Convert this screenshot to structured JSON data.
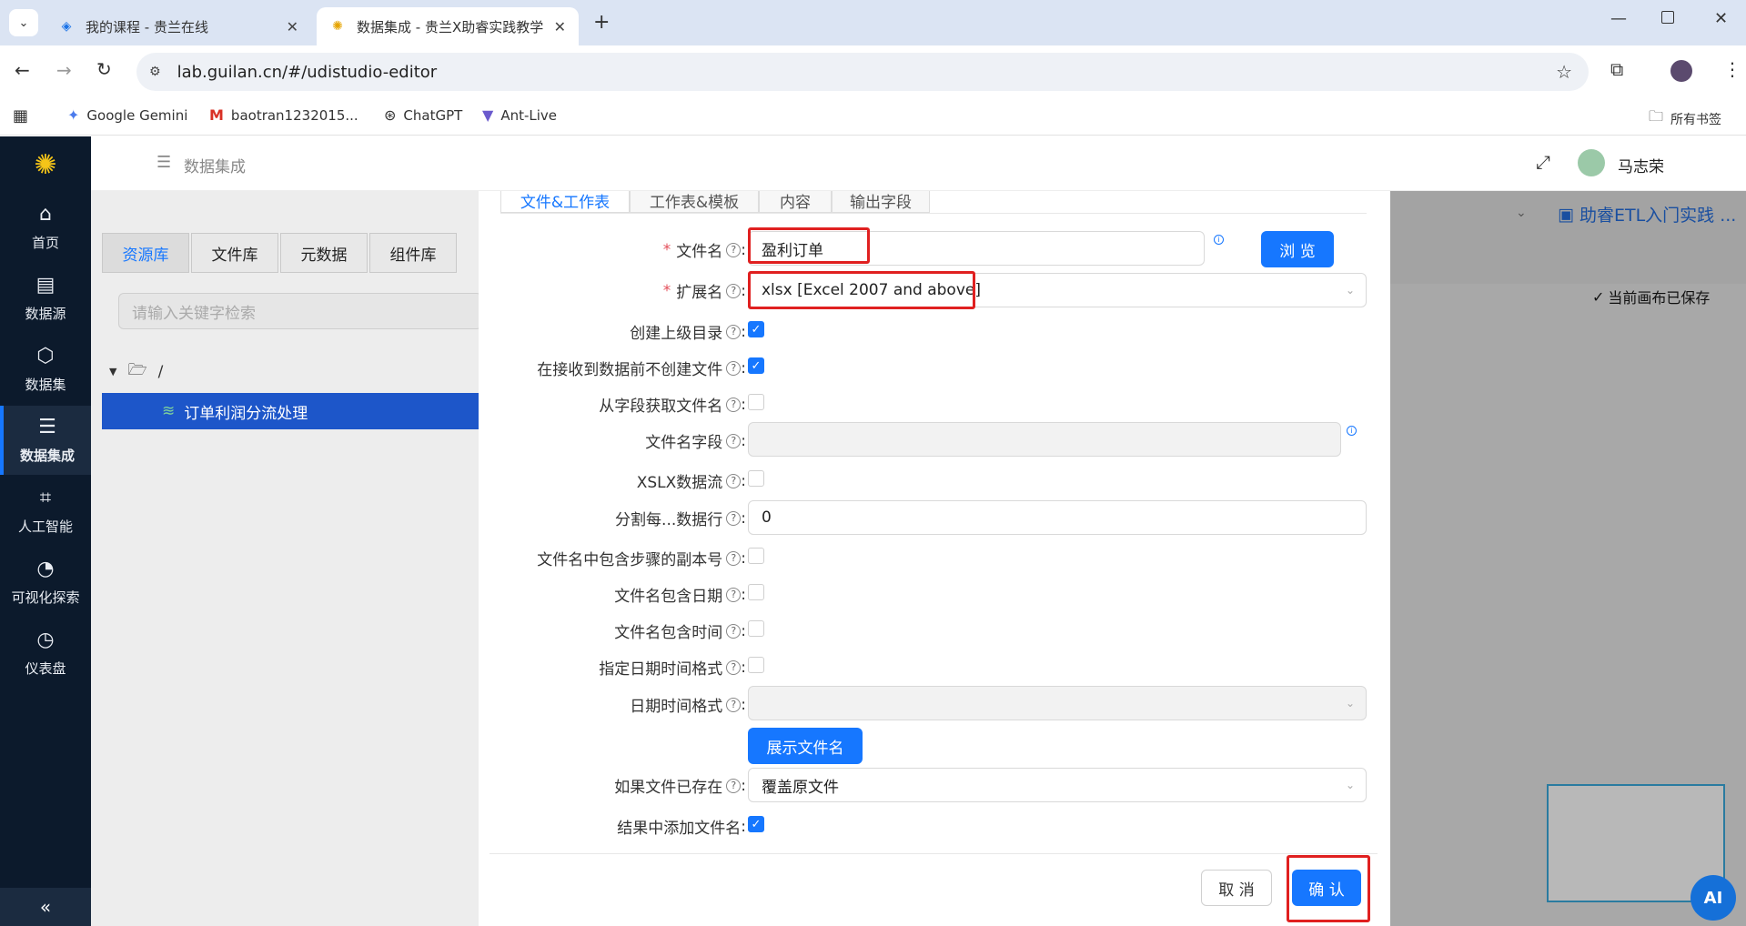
{
  "browser": {
    "tabs": [
      {
        "title": "我的课程 - 贵兰在线"
      },
      {
        "title": "数据集成 - 贵兰X助睿实践教学"
      }
    ],
    "url": "lab.guilan.cn/#/udistudio-editor",
    "bookmarks": [
      {
        "label": "Google Gemini"
      },
      {
        "label": "baotran1232015..."
      },
      {
        "label": "ChatGPT"
      },
      {
        "label": "Ant-Live"
      }
    ],
    "all_bookmarks_label": "所有书签"
  },
  "sidebar": {
    "items": [
      {
        "label": "首页",
        "icon": "home-icon"
      },
      {
        "label": "数据源",
        "icon": "database-icon"
      },
      {
        "label": "数据集",
        "icon": "cube-icon"
      },
      {
        "label": "数据集成",
        "icon": "server-icon"
      },
      {
        "label": "人工智能",
        "icon": "ai-icon"
      },
      {
        "label": "可视化探索",
        "icon": "pie-icon"
      },
      {
        "label": "仪表盘",
        "icon": "gauge-icon"
      }
    ],
    "active": "数据集成"
  },
  "header": {
    "breadcrumb": "数据集成",
    "user_name": "马志荣"
  },
  "left_panel": {
    "tabs": [
      "资源库",
      "文件库",
      "元数据",
      "组件库"
    ],
    "search_placeholder": "请输入关键字检索",
    "root": "/",
    "tree_item": "订单利润分流处理"
  },
  "canvas": {
    "title": "助睿ETL入门实践 ...",
    "save_status": "当前画布已保存",
    "ai_label": "AI"
  },
  "modal": {
    "tabs": [
      "文件&工作表",
      "工作表&模板",
      "内容",
      "输出字段"
    ],
    "fields": {
      "filename_label": "文件名",
      "filename_value": "盈利订单",
      "browse_button": "浏 览",
      "extension_label": "扩展名",
      "extension_value": "xlsx [Excel 2007 and above]",
      "create_parent_label": "创建上级目录",
      "no_create_label": "在接收到数据前不创建文件",
      "from_field_label": "从字段获取文件名",
      "filename_field_label": "文件名字段",
      "xslx_stream_label": "XSLX数据流",
      "split_label": "分割每...数据行",
      "split_value": "0",
      "copy_num_label": "文件名中包含步骤的副本号",
      "include_date_label": "文件名包含日期",
      "include_time_label": "文件名包含时间",
      "specify_format_label": "指定日期时间格式",
      "datetime_format_label": "日期时间格式",
      "show_filename_button": "展示文件名",
      "if_exists_label": "如果文件已存在",
      "if_exists_value": "覆盖原文件",
      "add_filename_label": "结果中添加文件名"
    },
    "checks": {
      "create_parent": true,
      "no_create": true,
      "from_field": false,
      "xslx_stream": false,
      "copy_num": false,
      "include_date": false,
      "include_time": false,
      "specify_format": false,
      "add_filename": true
    },
    "cancel_button": "取 消",
    "ok_button": "确 认"
  },
  "colors": {
    "primary": "#1677ff",
    "sidebar": "#0c1a2c",
    "highlight": "#e02020"
  }
}
